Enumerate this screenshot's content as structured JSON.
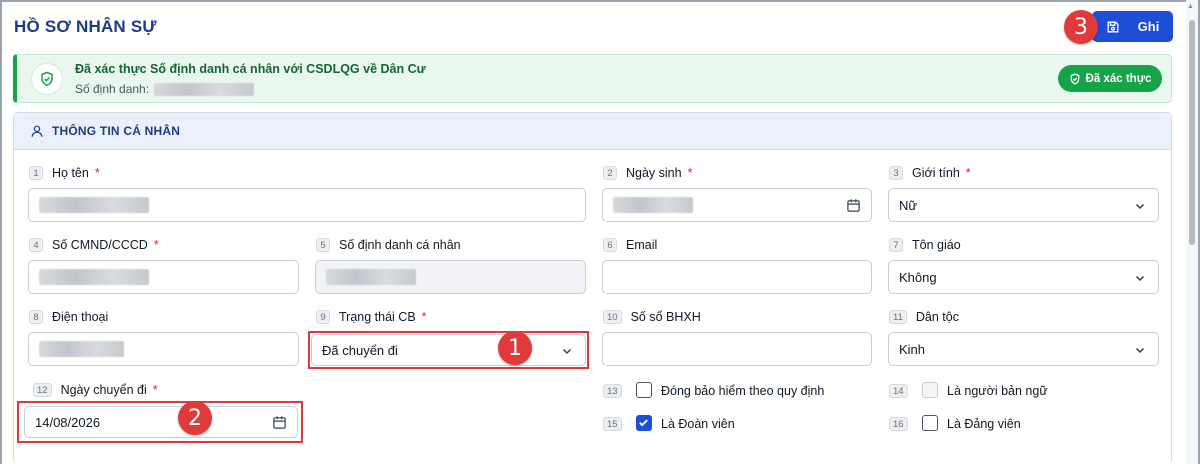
{
  "page": {
    "title": "HỒ SƠ NHÂN SỰ"
  },
  "toolbar": {
    "save_label": "Ghi"
  },
  "callouts": {
    "c1": "1",
    "c2": "2",
    "c3": "3"
  },
  "verification": {
    "title": "Đã xác thực Số định danh cá nhân với CSDLQG về Dân Cư",
    "sub_label": "Số định danh:",
    "badge": "Đã xác thực"
  },
  "section": {
    "title": "THÔNG TIN CÁ NHÂN"
  },
  "fields": {
    "f1": {
      "num": "1",
      "label": "Họ tên",
      "required": "*"
    },
    "f2": {
      "num": "2",
      "label": "Ngày sinh",
      "required": "*"
    },
    "f3": {
      "num": "3",
      "label": "Giới tính",
      "required": "*",
      "value": "Nữ"
    },
    "f4": {
      "num": "4",
      "label": "Số CMND/CCCD",
      "required": "*"
    },
    "f5": {
      "num": "5",
      "label": "Số định danh cá nhân"
    },
    "f6": {
      "num": "6",
      "label": "Email"
    },
    "f7": {
      "num": "7",
      "label": "Tôn giáo",
      "value": "Không"
    },
    "f8": {
      "num": "8",
      "label": "Điện thoại"
    },
    "f9": {
      "num": "9",
      "label": "Trạng thái CB",
      "required": "*",
      "value": "Đã chuyển đi"
    },
    "f10": {
      "num": "10",
      "label": "Số sổ BHXH"
    },
    "f11": {
      "num": "11",
      "label": "Dân tộc",
      "value": "Kinh"
    },
    "f12": {
      "num": "12",
      "label": "Ngày chuyển đi",
      "required": "*",
      "value": "14/08/2026"
    },
    "f13": {
      "num": "13",
      "label": "Đóng bảo hiểm theo quy định",
      "checked": false
    },
    "f14": {
      "num": "14",
      "label": "Là người bản ngữ",
      "checked": false,
      "disabled": true
    },
    "f15": {
      "num": "15",
      "label": "Là Đoàn viên",
      "checked": true
    },
    "f16": {
      "num": "16",
      "label": "Là Đảng viên",
      "checked": false
    }
  },
  "colors": {
    "primary": "#1d4ed8",
    "success": "#16a34a",
    "danger": "#dc2626",
    "callout": "#e03a3a"
  }
}
